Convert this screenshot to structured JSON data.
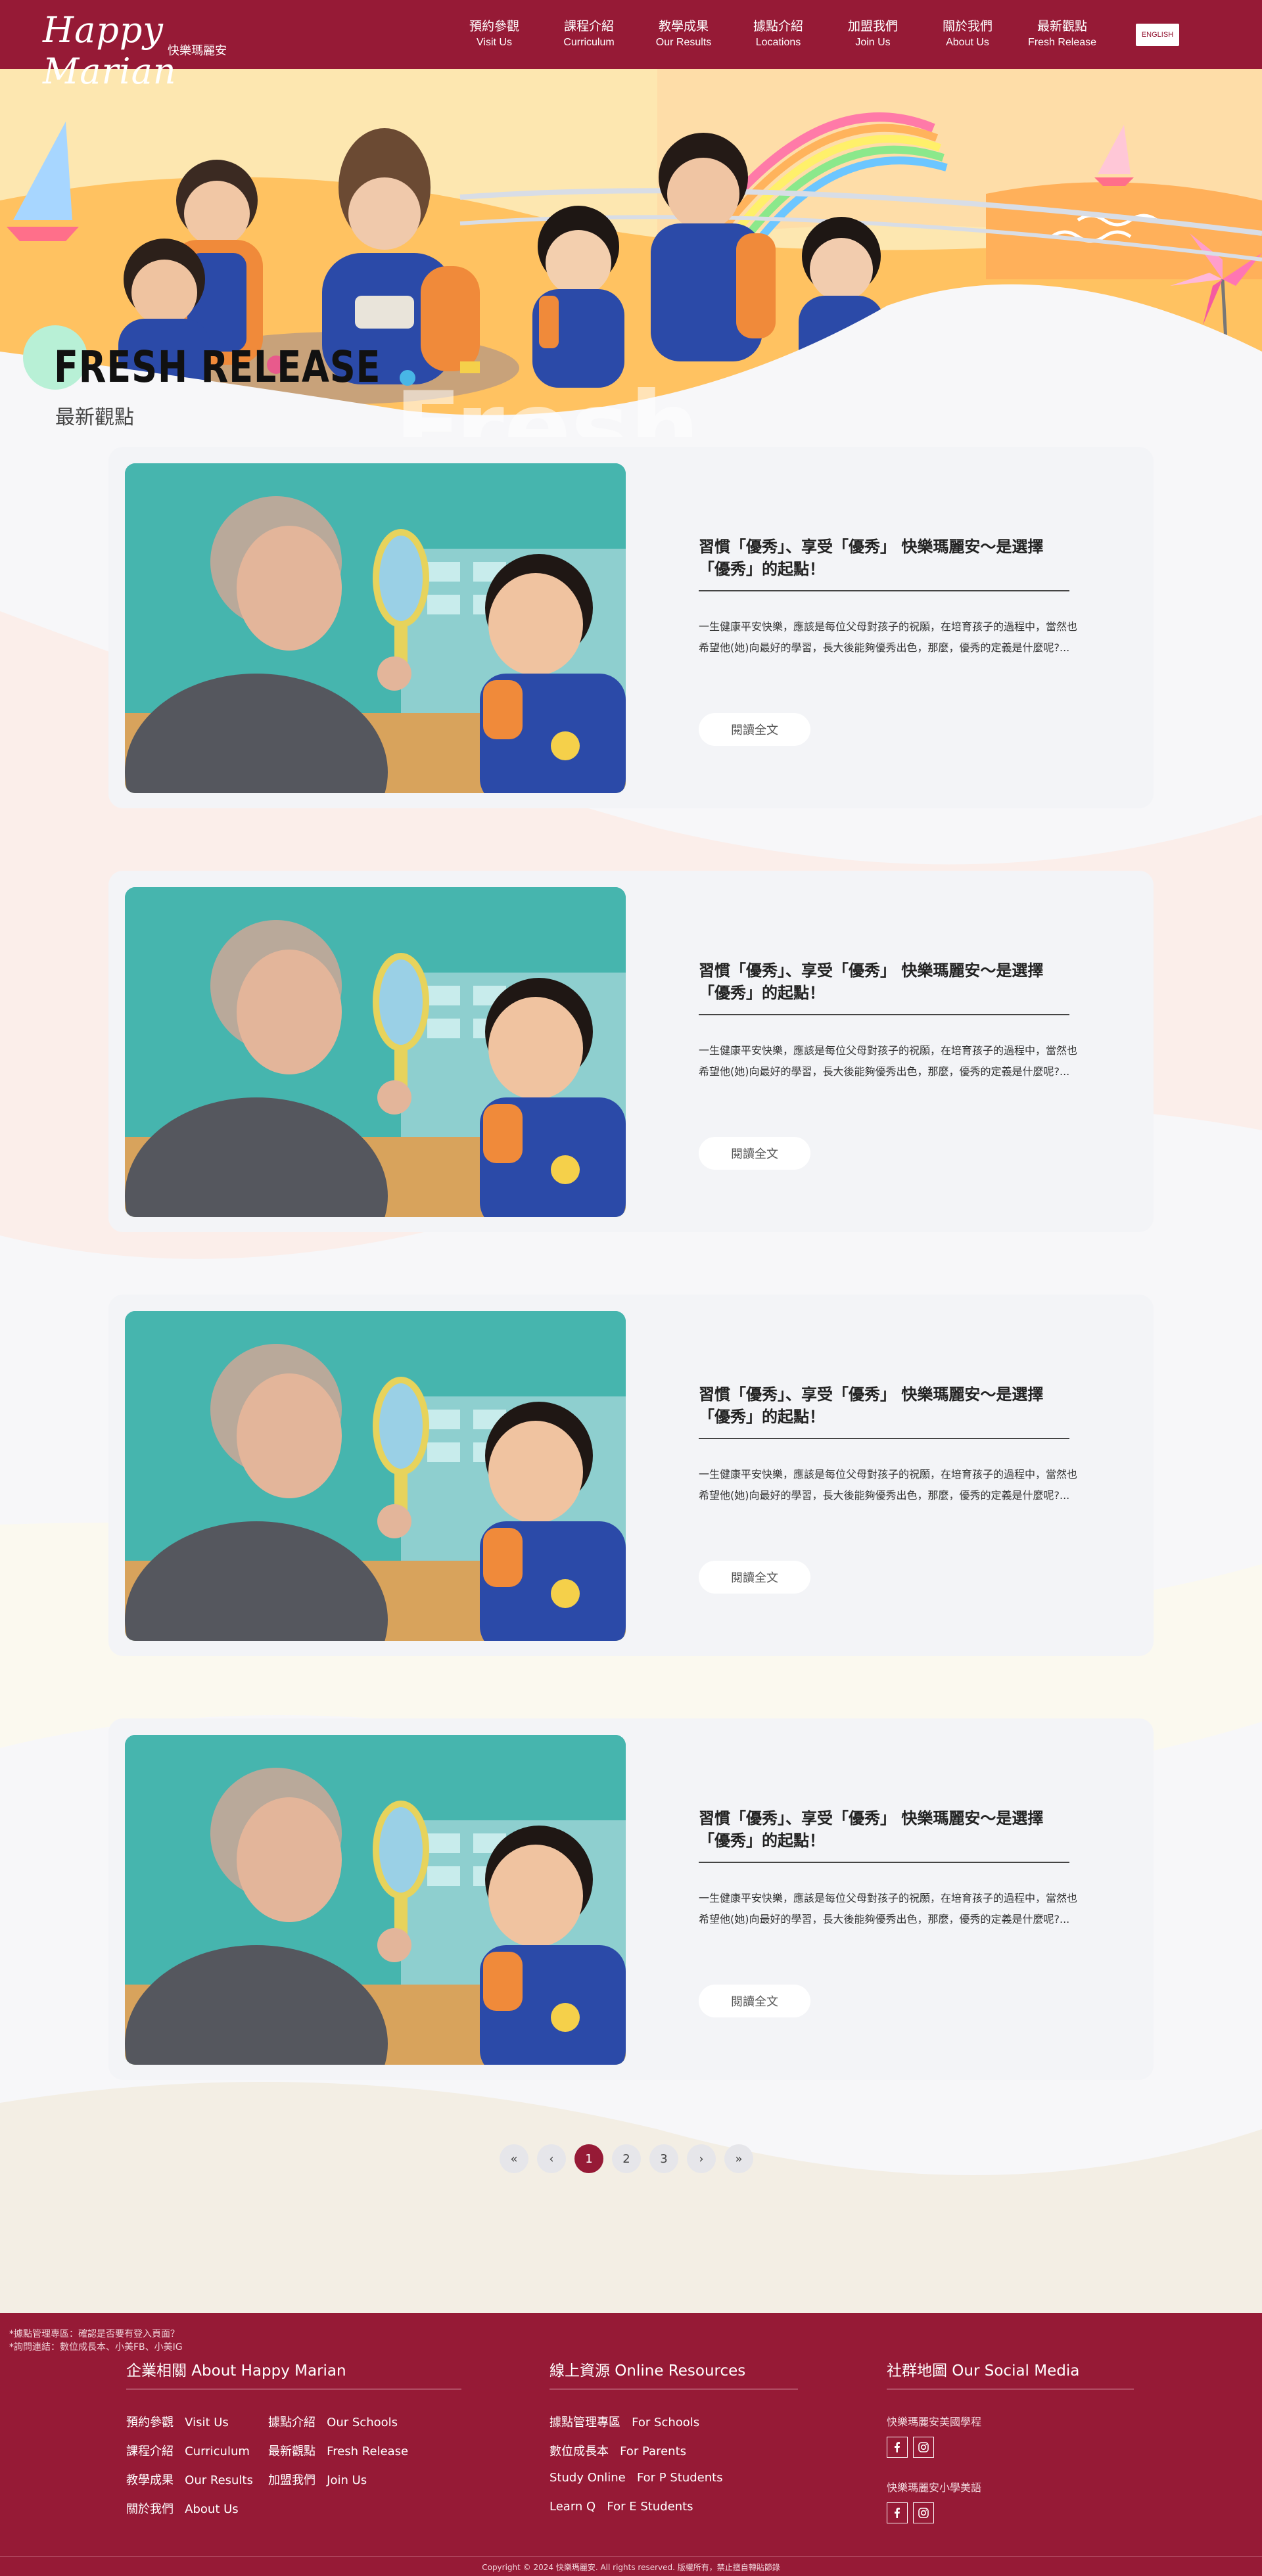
{
  "nav": {
    "logo_en": "Happy Marian",
    "logo_zh": "快樂瑪麗安",
    "items": [
      {
        "zh": "預約參觀",
        "en": "Visit Us"
      },
      {
        "zh": "課程介紹",
        "en": "Curriculum"
      },
      {
        "zh": "教學成果",
        "en": "Our Results"
      },
      {
        "zh": "據點介紹",
        "en": "Locations"
      },
      {
        "zh": "加盟我們",
        "en": "Join Us"
      },
      {
        "zh": "關於我們",
        "en": "About Us"
      },
      {
        "zh": "最新觀點",
        "en": "Fresh Release"
      }
    ],
    "lang_button": "ENGLISH"
  },
  "hero": {
    "title": "FRESH RELEASE",
    "subtitle": "最新觀點",
    "watermark": "Fresh"
  },
  "articles": [
    {
      "title": "習慣「優秀」、享受「優秀」 快樂瑪麗安～是選擇「優秀」的起點！",
      "excerpt": "一生健康平安快樂，應該是每位父母對孩子的祝願，在培育孩子的過程中，當然也希望他(她)向最好的學習，長大後能夠優秀出色，那麼，優秀的定義是什麼呢?...",
      "button": "閱讀全文"
    },
    {
      "title": "習慣「優秀」、享受「優秀」 快樂瑪麗安～是選擇「優秀」的起點！",
      "excerpt": "一生健康平安快樂，應該是每位父母對孩子的祝願，在培育孩子的過程中，當然也希望他(她)向最好的學習，長大後能夠優秀出色，那麼，優秀的定義是什麼呢?...",
      "button": "閱讀全文"
    },
    {
      "title": "習慣「優秀」、享受「優秀」 快樂瑪麗安～是選擇「優秀」的起點！",
      "excerpt": "一生健康平安快樂，應該是每位父母對孩子的祝願，在培育孩子的過程中，當然也希望他(她)向最好的學習，長大後能夠優秀出色，那麼，優秀的定義是什麼呢?...",
      "button": "閱讀全文"
    },
    {
      "title": "習慣「優秀」、享受「優秀」 快樂瑪麗安～是選擇「優秀」的起點！",
      "excerpt": "一生健康平安快樂，應該是每位父母對孩子的祝願，在培育孩子的過程中，當然也希望他(她)向最好的學習，長大後能夠優秀出色，那麼，優秀的定義是什麼呢?...",
      "button": "閱讀全文"
    }
  ],
  "pagination": {
    "first": "«",
    "prev": "‹",
    "pages": [
      "1",
      "2",
      "3"
    ],
    "current": "1",
    "next": "›",
    "last": "»"
  },
  "footer": {
    "notes": [
      "*據點管理專區：確認是否要有登入頁面？",
      "*詢問連結：數位成長本、小美FB、小美IG"
    ],
    "about": {
      "title": "企業相關 About Happy Marian",
      "links": [
        {
          "zh": "預約參觀",
          "en": "Visit Us"
        },
        {
          "zh": "據點介紹",
          "en": "Our Schools"
        },
        {
          "zh": "課程介紹",
          "en": "Curriculum"
        },
        {
          "zh": "最新觀點",
          "en": "Fresh Release"
        },
        {
          "zh": "教學成果",
          "en": "Our Results"
        },
        {
          "zh": "加盟我們",
          "en": "Join Us"
        },
        {
          "zh": "關於我們",
          "en": "About Us"
        }
      ]
    },
    "resources": {
      "title": "線上資源 Online Resources",
      "links": [
        {
          "zh": "據點管理專區",
          "en": "For Schools"
        },
        {
          "zh": "數位成長本",
          "en": "For Parents"
        },
        {
          "zh": "Study Online",
          "en": "For P Students"
        },
        {
          "zh": "Learn Q",
          "en": "For E Students"
        }
      ]
    },
    "social": {
      "title": "社群地圖 Our Social Media",
      "groups": [
        {
          "label": "快樂瑪麗安美國學程",
          "icons": [
            "facebook-icon",
            "instagram-icon"
          ]
        },
        {
          "label": "快樂瑪麗安小學美語",
          "icons": [
            "facebook-icon",
            "instagram-icon"
          ]
        }
      ]
    },
    "copyright": "Copyright © 2024 快樂瑪麗安. All rights reserved. 版權所有，禁止擅自轉貼節錄"
  },
  "colors": {
    "brand": "#961a36",
    "card_bg": "#f3f4f7",
    "mint": "#b8f0d6"
  }
}
